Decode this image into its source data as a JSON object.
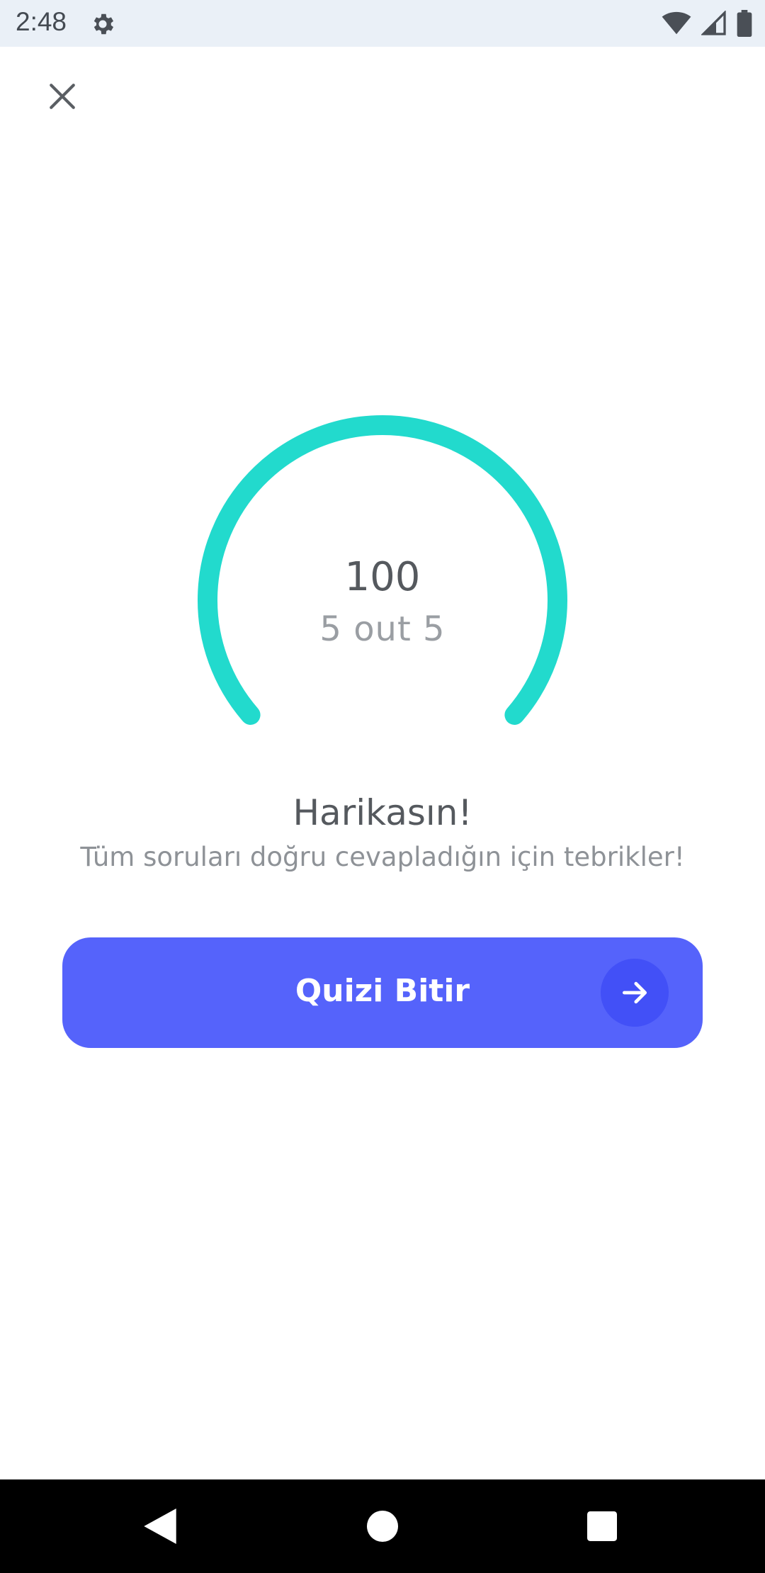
{
  "status_bar": {
    "time": "2:48",
    "icons": [
      "gear-icon",
      "wifi-icon",
      "signal-icon",
      "battery-icon"
    ]
  },
  "close": {
    "icon": "close-icon"
  },
  "result": {
    "score": "100",
    "detail": "5 out 5",
    "progress_fraction": 1.0,
    "headline": "Harikasın!",
    "message": "Tüm soruları doğru cevapladığın için tebrikler!"
  },
  "finish_button": {
    "label": "Quizi Bitir",
    "icon": "arrow-right-icon"
  },
  "nav_bar": {
    "buttons": [
      "back-icon",
      "home-icon",
      "recents-icon"
    ]
  },
  "colors": {
    "accent": "#22dacd",
    "button": "#5563fb",
    "button_icon_bg": "#4250f7",
    "status_bar_bg": "#eaf0f7"
  }
}
